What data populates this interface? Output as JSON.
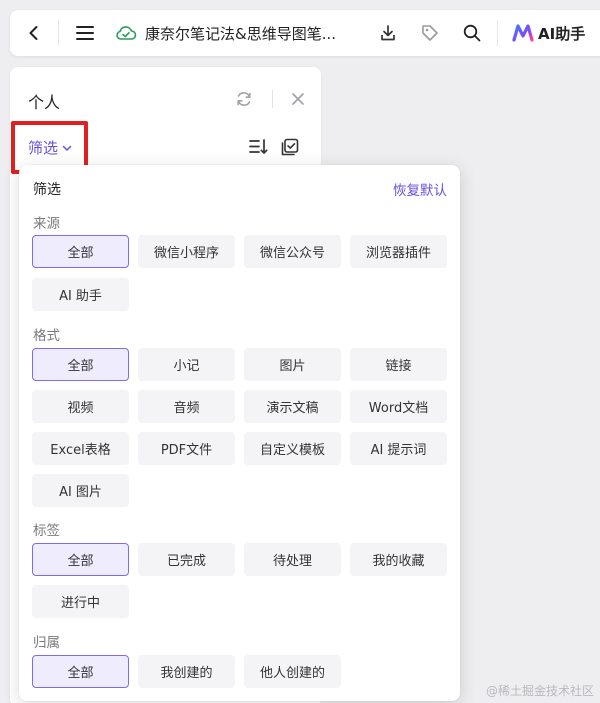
{
  "toolbar": {
    "doc_title": "康奈尔笔记法&思维导图笔...",
    "ai_label": "AI助手"
  },
  "panel": {
    "title": "个人",
    "filter_label": "筛选"
  },
  "popover": {
    "title": "筛选",
    "reset_label": "恢复默认",
    "sections": {
      "source": {
        "label": "来源",
        "chips": [
          "全部",
          "微信小程序",
          "微信公众号",
          "浏览器插件",
          "AI 助手"
        ]
      },
      "format": {
        "label": "格式",
        "chips": [
          "全部",
          "小记",
          "图片",
          "链接",
          "视频",
          "音频",
          "演示文稿",
          "Word文档",
          "Excel表格",
          "PDF文件",
          "自定义模板",
          "AI 提示词",
          "AI 图片"
        ]
      },
      "tags": {
        "label": "标签",
        "chips": [
          "全部",
          "已完成",
          "待处理",
          "我的收藏",
          "进行中"
        ]
      },
      "owner": {
        "label": "归属",
        "chips": [
          "全部",
          "我创建的",
          "他人创建的"
        ]
      }
    }
  },
  "watermark": "@稀土掘金技术社区",
  "colors": {
    "accent": "#6650e0",
    "selected_bg": "#eeecfd",
    "selected_border": "#7d6cf0",
    "highlight": "#e02020"
  }
}
